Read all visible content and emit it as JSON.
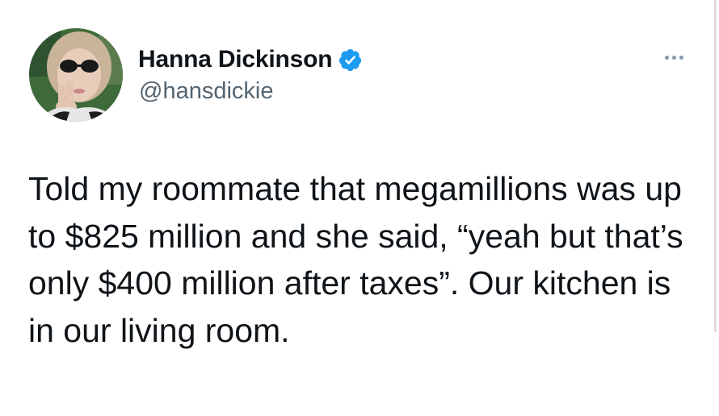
{
  "author": {
    "display_name": "Hanna Dickinson",
    "handle": "@hansdickie",
    "verified": true,
    "avatar_icon": "profile-photo"
  },
  "tweet": {
    "text": "Told my roommate that megamillions was up to $825 million and she said, “yeah but that’s only $400 million after taxes”. Our kitchen is in our living room."
  },
  "icons": {
    "verified": "verified-badge-icon",
    "more": "more-options-icon"
  },
  "colors": {
    "verified": "#1d9bf0",
    "text": "#0f1419",
    "secondary": "#536471"
  }
}
